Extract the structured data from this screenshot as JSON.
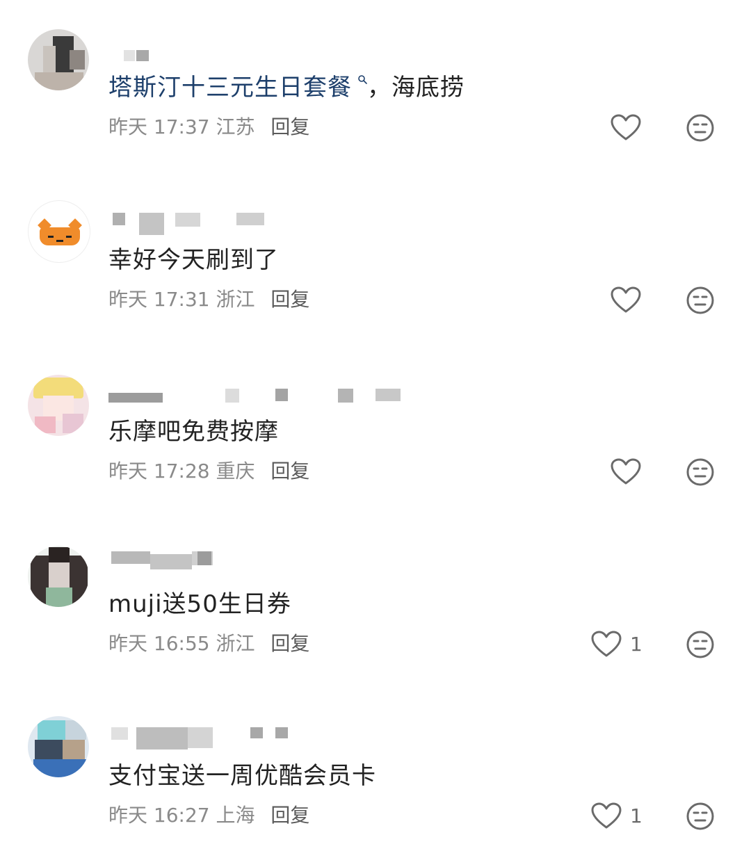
{
  "comments": [
    {
      "content_keyword": "塔斯汀十三元生日套餐",
      "content_suffix": "，海底捞",
      "time": "昨天 17:37",
      "location": "江苏",
      "reply_label": "回复",
      "like_count": ""
    },
    {
      "content": "幸好今天刷到了",
      "time": "昨天 17:31",
      "location": "浙江",
      "reply_label": "回复",
      "like_count": ""
    },
    {
      "content": "乐摩吧免费按摩",
      "time": "昨天 17:28",
      "location": "重庆",
      "reply_label": "回复",
      "like_count": ""
    },
    {
      "content": "muji送50生日券",
      "time": "昨天 16:55",
      "location": "浙江",
      "reply_label": "回复",
      "like_count": "1"
    },
    {
      "content": "支付宝送一周优酷会员卡",
      "time": "昨天 16:27",
      "location": "上海",
      "reply_label": "回复",
      "like_count": "1"
    }
  ],
  "colors": {
    "text": "#222222",
    "keyword": "#1d3f6b",
    "meta": "#8a8a8a",
    "icon": "#6a6a6a"
  },
  "icons": {
    "like": "heart-outline-icon",
    "dislike": "neutral-face-icon",
    "keyword_search": "search-icon"
  }
}
